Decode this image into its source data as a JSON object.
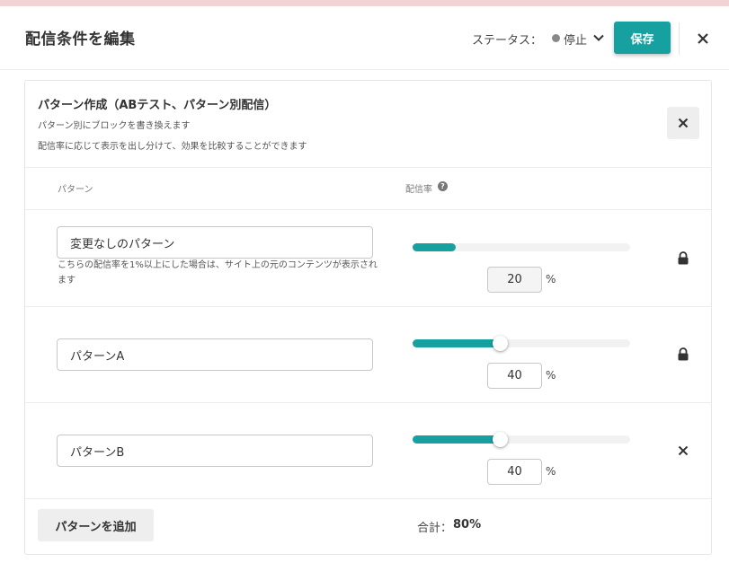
{
  "header": {
    "title": "配信条件を編集",
    "status_label": "ステータス：",
    "status_value": "停止",
    "save_label": "保存"
  },
  "colors": {
    "accent": "#17a0a0",
    "status_dot": "#888888",
    "top_strip": "#f3d2d4"
  },
  "card": {
    "title": "パターン作成（ABテスト、パターン別配信）",
    "desc1": "パターン別にブロックを書き換えます",
    "desc2": "配信率に応じて表示を出し分けて、効果を比較することができます",
    "col_pattern": "パターン",
    "col_rate": "配信率",
    "help_glyph": "?"
  },
  "patterns": [
    {
      "name": "変更なしのパターン",
      "note": "こちらの配信率を1%以上にした場合は、サイト上の元のコンテンツが表示されます",
      "rate": "20",
      "fraction": 0.2,
      "unit": "%",
      "action_icon": "lock-icon"
    },
    {
      "name": "パターンA",
      "note": "",
      "rate": "40",
      "fraction": 0.4,
      "unit": "%",
      "action_icon": "lock-icon"
    },
    {
      "name": "パターンB",
      "note": "",
      "rate": "40",
      "fraction": 0.4,
      "unit": "%",
      "action_icon": "close-icon"
    }
  ],
  "footer": {
    "add_label": "パターンを追加",
    "total_label": "合計：",
    "total_value": "80%"
  }
}
